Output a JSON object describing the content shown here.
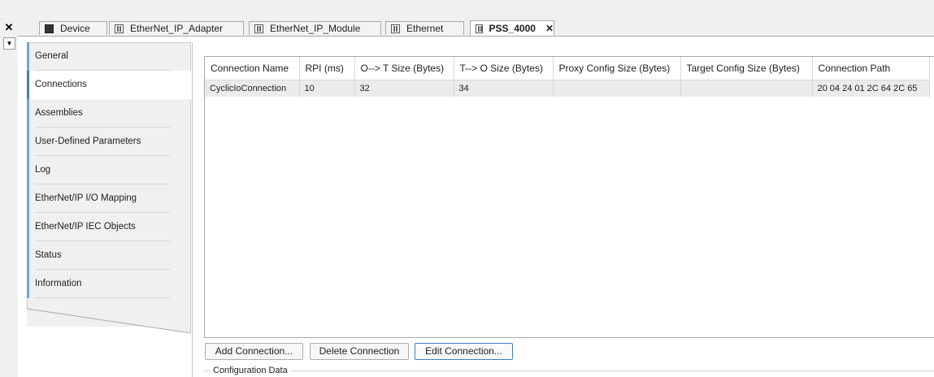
{
  "window": {
    "close_glyph": "✕",
    "dropdown_glyph": "▼"
  },
  "tabs": [
    {
      "label": "Device",
      "icon": "device-icon",
      "active": false
    },
    {
      "label": "EtherNet_IP_Adapter",
      "icon": "module-icon",
      "active": false
    },
    {
      "label": "EtherNet_IP_Module",
      "icon": "module-icon",
      "active": false
    },
    {
      "label": "Ethernet",
      "icon": "module-icon",
      "active": false
    },
    {
      "label": "PSS_4000",
      "icon": "module-icon",
      "active": true,
      "close_glyph": "✕"
    }
  ],
  "nav": {
    "items": [
      {
        "label": "General"
      },
      {
        "label": "Connections"
      },
      {
        "label": "Assemblies"
      },
      {
        "label": "User-Defined Parameters"
      },
      {
        "label": "Log"
      },
      {
        "label": "EtherNet/IP I/O Mapping"
      },
      {
        "label": "EtherNet/IP IEC Objects"
      },
      {
        "label": "Status"
      },
      {
        "label": "Information"
      }
    ],
    "active_label": "Connections"
  },
  "connections_table": {
    "columns": [
      "Connection Name",
      "RPI (ms)",
      "O--> T Size (Bytes)",
      "T--> O Size (Bytes)",
      "Proxy Config Size (Bytes)",
      "Target Config Size (Bytes)",
      "Connection Path"
    ],
    "rows": [
      [
        "CyclicIoConnection",
        "10",
        "32",
        "34",
        "",
        "",
        "20 04 24 01 2C 64 2C 65"
      ]
    ]
  },
  "buttons": {
    "add": "Add Connection...",
    "delete": "Delete Connection",
    "edit": "Edit Connection..."
  },
  "section": {
    "configuration_data": "Configuration Data"
  },
  "colors": {
    "accent": "#3c7fc1",
    "nav_bar": "#6fa8dc"
  }
}
